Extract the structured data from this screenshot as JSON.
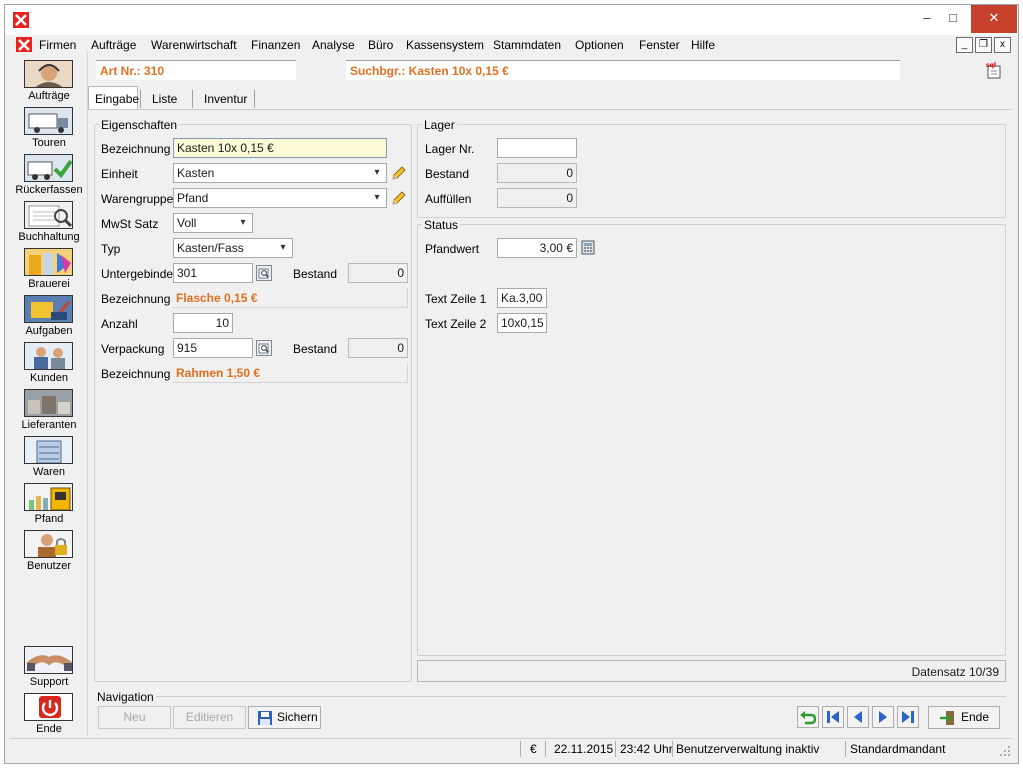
{
  "window": {
    "minimize": "–",
    "maximize": "□",
    "close": "✕"
  },
  "menu": {
    "items": [
      "Firmen",
      "Aufträge",
      "Warenwirtschaft",
      "Finanzen",
      "Analyse",
      "Büro",
      "Kassensystem",
      "Stammdaten",
      "Optionen",
      "Fenster",
      "Hilfe"
    ],
    "mdi_min": "_",
    "mdi_restore": "❐",
    "mdi_close": "x"
  },
  "sidebar": {
    "items": [
      "Aufträge",
      "Touren",
      "Rückerfassen",
      "Buchhaltung",
      "Brauerei",
      "Aufgaben",
      "Kunden",
      "Lieferanten",
      "Waren",
      "Pfand",
      "Benutzer"
    ],
    "support": "Support",
    "ende": "Ende"
  },
  "header": {
    "art_nr": "Art Nr.: 310",
    "suchbegriff": "Suchbgr.: Kasten 10x 0,15 €"
  },
  "tabs": [
    "Eingabe",
    "Liste",
    "Inventur"
  ],
  "eigenschaften": {
    "title": "Eigenschaften",
    "bezeichnung_label": "Bezeichnung",
    "bezeichnung_value": "Kasten 10x 0,15 €",
    "einheit_label": "Einheit",
    "einheit_value": "Kasten",
    "warengruppe_label": "Warengruppe",
    "warengruppe_value": "Pfand",
    "mwst_label": "MwSt Satz",
    "mwst_value": "Voll",
    "typ_label": "Typ",
    "typ_value": "Kasten/Fass",
    "untergebinde_label": "Untergebinde",
    "untergebinde_value": "301",
    "bestand1_label": "Bestand",
    "bestand1_value": "0",
    "bezeichnung2_label": "Bezeichnung",
    "bezeichnung2_value": "Flasche 0,15 €",
    "anzahl_label": "Anzahl",
    "anzahl_value": "10",
    "verpackung_label": "Verpackung",
    "verpackung_value": "915",
    "bestand2_label": "Bestand",
    "bestand2_value": "0",
    "bezeichnung3_label": "Bezeichnung",
    "bezeichnung3_value": "Rahmen 1,50 €"
  },
  "lager": {
    "title": "Lager",
    "lager_nr_label": "Lager Nr.",
    "lager_nr_value": "",
    "bestand_label": "Bestand",
    "bestand_value": "0",
    "auffuellen_label": "Auffüllen",
    "auffuellen_value": "0"
  },
  "status": {
    "title": "Status",
    "pfandwert_label": "Pfandwert",
    "pfandwert_value": "3,00 €",
    "textzeile1_label": "Text Zeile 1",
    "textzeile1_value": "Ka.3,00",
    "textzeile2_label": "Text Zeile 2",
    "textzeile2_value": "10x0,15",
    "datensatz": "Datensatz 10/39"
  },
  "navigation": {
    "title": "Navigation",
    "neu": "Neu",
    "editieren": "Editieren",
    "sichern": "Sichern",
    "ende": "Ende"
  },
  "statusbar": {
    "currency": "€",
    "date": "22.11.2015",
    "time": "23:42 Uhr",
    "user_status": "Benutzerverwaltung inaktiv",
    "mandant": "Standardmandant"
  },
  "colors": {
    "accent_orange": "#e07020",
    "brand_red": "#e8231f",
    "close_red": "#c7402c"
  }
}
